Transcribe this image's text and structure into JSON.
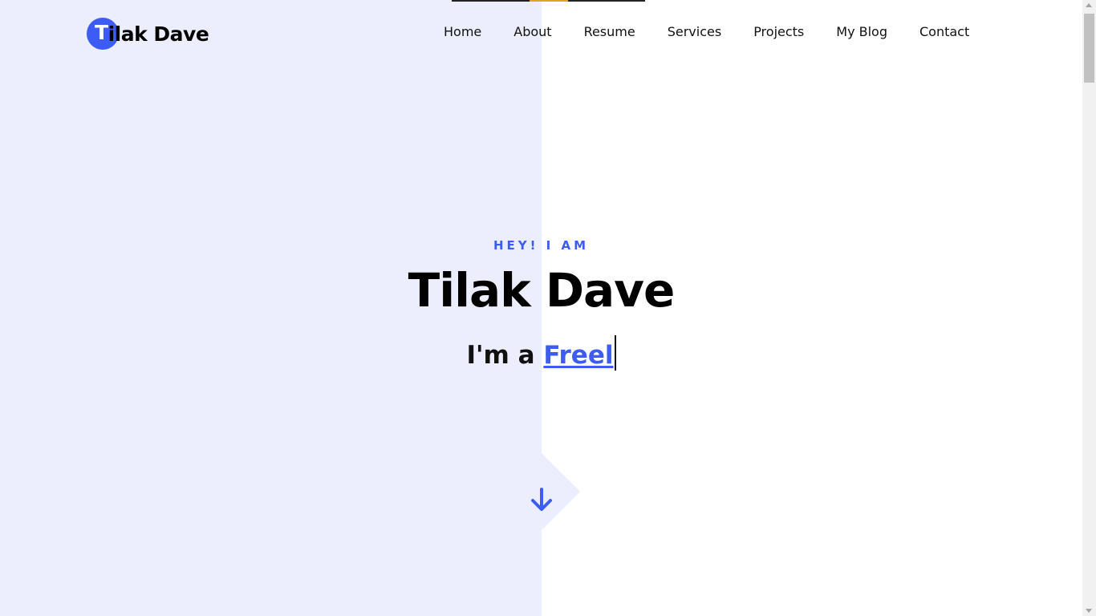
{
  "logo": {
    "first_letter": "T",
    "rest": "ilak Dave"
  },
  "nav": {
    "items": [
      "Home",
      "About",
      "Resume",
      "Services",
      "Projects",
      "My Blog",
      "Contact"
    ]
  },
  "hero": {
    "kicker": "HEY! I AM",
    "name": "Tilak Dave",
    "role_prefix": "I'm a ",
    "role_typed": "Freel"
  },
  "icons": {
    "scroll": "arrow-down-icon"
  },
  "colors": {
    "accent": "#3d5cf5",
    "left_panel": "#eceefe",
    "top_accent": "#e0a32a"
  }
}
